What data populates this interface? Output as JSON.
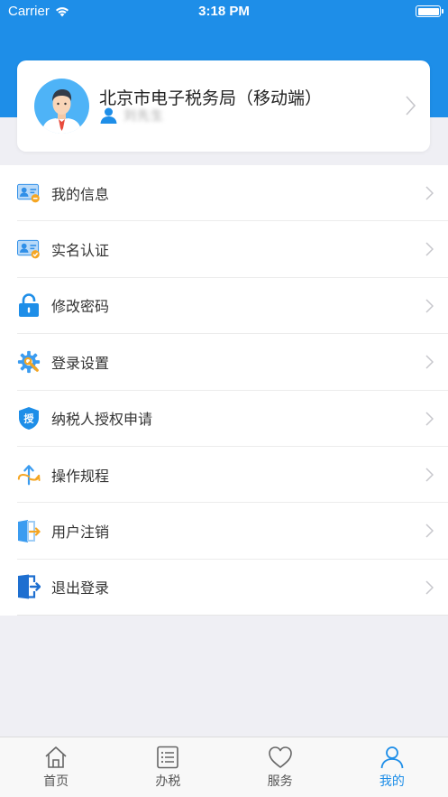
{
  "status_bar": {
    "carrier": "Carrier",
    "time": "3:18 PM"
  },
  "profile": {
    "title": "北京市电子税务局（移动端）",
    "username": "刘先生"
  },
  "menu": {
    "items": [
      {
        "label": "我的信息",
        "icon": "id-card-icon"
      },
      {
        "label": "实名认证",
        "icon": "verified-card-icon"
      },
      {
        "label": "修改密码",
        "icon": "padlock-icon"
      },
      {
        "label": "登录设置",
        "icon": "gear-wrench-icon"
      },
      {
        "label": "纳税人授权申请",
        "icon": "authorization-shield-icon"
      },
      {
        "label": "操作规程",
        "icon": "process-arrows-icon"
      },
      {
        "label": "用户注销",
        "icon": "door-exit-icon"
      },
      {
        "label": "退出登录",
        "icon": "logout-icon"
      }
    ]
  },
  "tab_bar": {
    "tabs": [
      {
        "label": "首页",
        "icon": "home-icon",
        "active": false
      },
      {
        "label": "办税",
        "icon": "list-icon",
        "active": false
      },
      {
        "label": "服务",
        "icon": "heart-icon",
        "active": false
      },
      {
        "label": "我的",
        "icon": "person-icon",
        "active": true
      }
    ]
  },
  "colors": {
    "brand_blue": "#1e8ee8",
    "background": "#efeff4"
  }
}
